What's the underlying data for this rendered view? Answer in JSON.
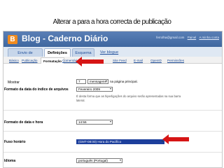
{
  "headline": "Alterar a para a hora correcta de publicação",
  "blog": {
    "logo_letter": "B",
    "title": "Blog - Caderno Diário",
    "user_email": "ferrolha@gmail.com",
    "panel_link": "Painel",
    "account_link": "A minha conta"
  },
  "tabs": [
    {
      "label": "Envio de mensagens"
    },
    {
      "label": "Definições"
    },
    {
      "label": "Esquema"
    },
    {
      "label": "Ver blogue"
    }
  ],
  "subtabs": [
    "Básico",
    "Publicação",
    "Formatação",
    "Comentários",
    "Arquivo",
    "Site Feed",
    "E-mail",
    "OpenID",
    "Permissões"
  ],
  "form": {
    "show": {
      "label": "Mostrar",
      "count": "7",
      "unit": "mensagens",
      "suffix": "na página principal."
    },
    "date_header": {
      "label": "Formato da data do índice de arquivos",
      "value": "Fevereiro 2009",
      "help": "É desta forma que as hiperligações do arquivo serão apresentadas na sua barra lateral."
    },
    "timestamp": {
      "label": "Formato de data e hora",
      "value": "14:56"
    },
    "timezone": {
      "label": "Fuso horário",
      "value": "(GMT-08:00) Hora do Pacífico"
    },
    "language": {
      "label": "Idioma",
      "value": "português (Portugal)"
    }
  }
}
